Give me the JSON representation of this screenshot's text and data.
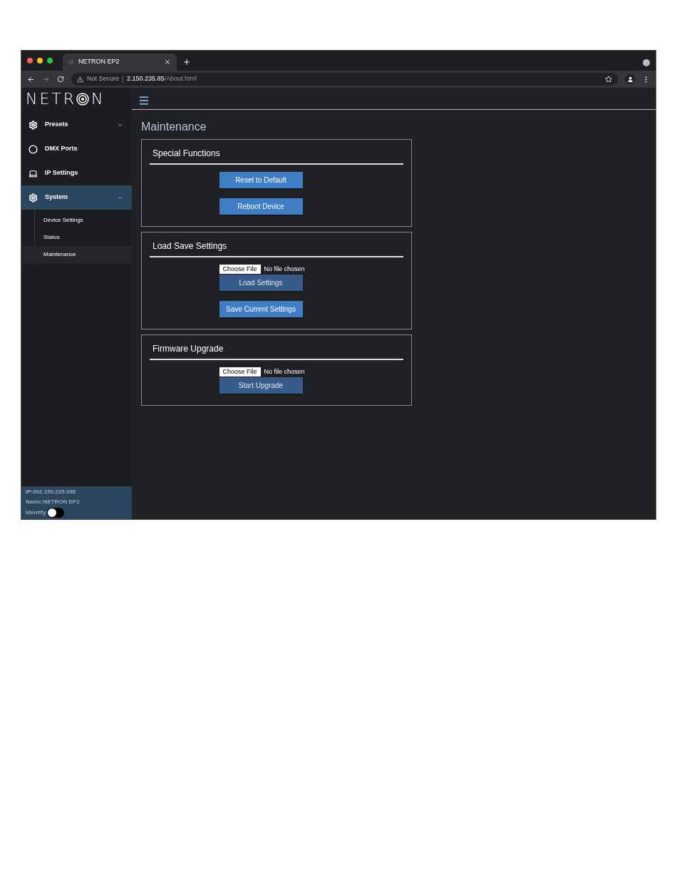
{
  "browser": {
    "tab": {
      "title": "NETRON EP2"
    },
    "address": {
      "security": "Not Secure",
      "host": "2.150.235.85",
      "path": "/About.html"
    }
  },
  "logo": {
    "before": "NETR",
    "after": "N"
  },
  "sidebar": {
    "items": [
      {
        "label": "Presets",
        "kind": "gear",
        "selected": false,
        "expandable": true
      },
      {
        "label": "DMX Ports",
        "kind": "ring",
        "selected": false,
        "expandable": false
      },
      {
        "label": "IP Settings",
        "kind": "laptop",
        "selected": false,
        "expandable": false
      },
      {
        "label": "System",
        "kind": "gear",
        "selected": true,
        "expandable": true,
        "children": [
          {
            "label": "Device Settings",
            "selected": false
          },
          {
            "label": "Status",
            "selected": false
          },
          {
            "label": "Maintenance",
            "selected": true
          }
        ]
      }
    ],
    "footer": {
      "ip": "IP:002.150.235.085",
      "name": "Name:NETRON EP2",
      "identify": {
        "label": "Identify",
        "on": false
      }
    }
  },
  "page": {
    "title": "Maintenance",
    "sections": [
      {
        "title": "Special Functions",
        "items": [
          {
            "kind": "button",
            "label": "Reset to Default",
            "disabled": false
          },
          {
            "kind": "button",
            "label": "Reboot Device",
            "disabled": false
          }
        ]
      },
      {
        "title": "Load Save Settings",
        "items": [
          {
            "kind": "file",
            "button": "Choose File",
            "status": "No file chosen"
          },
          {
            "kind": "button",
            "label": "Load Settings",
            "disabled": true
          },
          {
            "kind": "button",
            "label": "Save Current Settings",
            "disabled": false
          }
        ]
      },
      {
        "title": "Firmware Upgrade",
        "items": [
          {
            "kind": "file",
            "button": "Choose File",
            "status": "No file chosen"
          },
          {
            "kind": "button",
            "label": "Start Upgrade",
            "disabled": true
          }
        ]
      }
    ]
  }
}
